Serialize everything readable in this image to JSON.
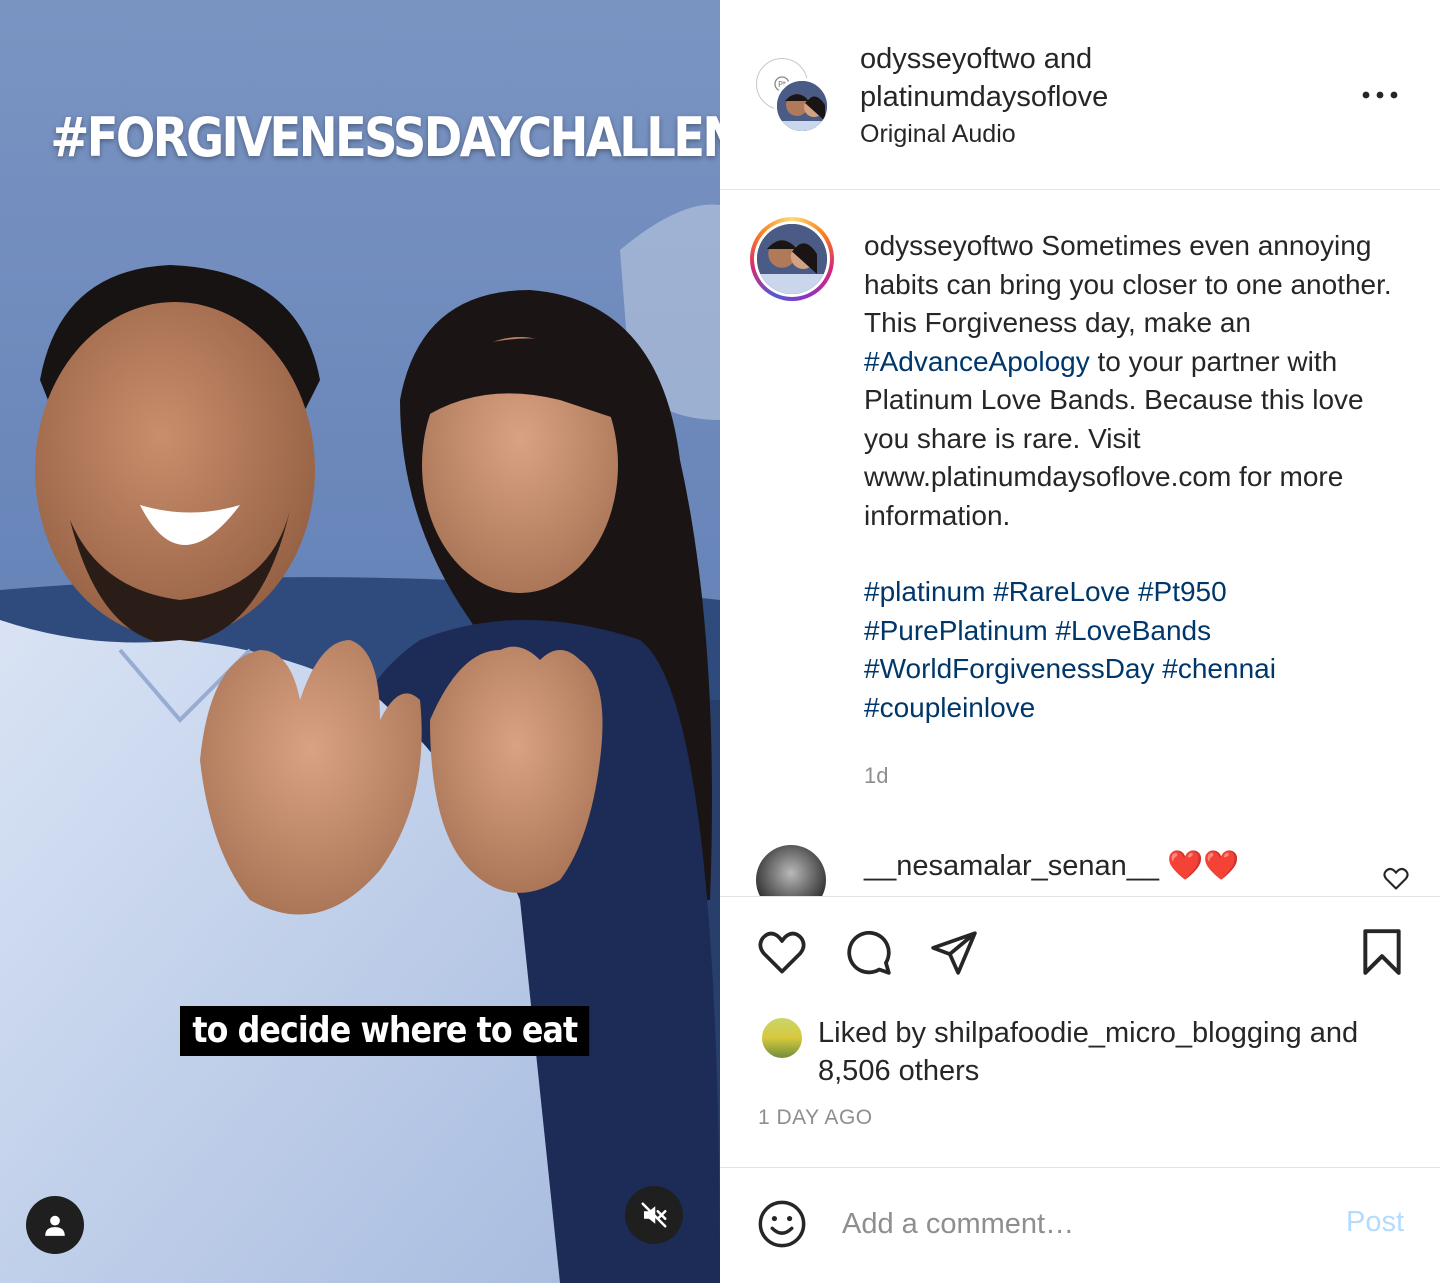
{
  "media": {
    "overlay_title": "#FORGIVENESSDAYCHALLENGE",
    "subtitle": "to decide where to eat",
    "tag_icon": "user-silhouette-icon",
    "mute_icon": "speaker-muted-icon"
  },
  "header": {
    "user1": "odysseyoftwo",
    "connector": "and",
    "user2": "platinumdaysoflove",
    "audio": "Original Audio",
    "more_icon": "ellipsis-icon"
  },
  "caption": {
    "username": "odysseyoftwo",
    "text_part1": "Sometimes even annoying habits can bring you closer to one another. This Forgiveness day, make an",
    "tag_advance": "#AdvanceApology",
    "text_part2": "to your partner with Platinum Love Bands. Because this love you share is rare. Visit www.platinumdaysoflove.com for more information.",
    "hashtags": [
      "#platinum",
      "#RareLove",
      "#Pt950",
      "#PurePlatinum",
      "#LoveBands",
      "#WorldForgivenessDay",
      "#chennai",
      "#coupleinlove"
    ],
    "time": "1d"
  },
  "comment": {
    "username": "__nesamalar_senan__",
    "emoji": "❤️❤️"
  },
  "actions": {
    "like_icon": "heart-outline-icon",
    "comment_icon": "comment-bubble-icon",
    "share_icon": "paper-plane-icon",
    "save_icon": "bookmark-icon"
  },
  "likes": {
    "prefix": "Liked by",
    "username": "shilpafoodie_micro_blogging",
    "connector": "and",
    "count": "8,506 others"
  },
  "post_age": "1 DAY AGO",
  "comment_box": {
    "placeholder": "Add a comment…",
    "post_label": "Post",
    "post_color": "#b3dbff",
    "link_color": "#00376b"
  }
}
